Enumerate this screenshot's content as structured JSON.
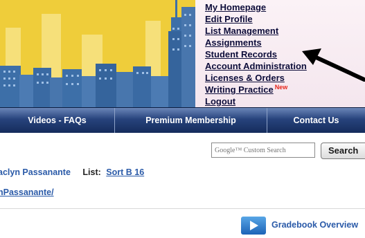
{
  "colors": {
    "banner_yellow": "#f1cf3a",
    "skyline_blue": "#3d6fa8",
    "menu_text": "#0d0d3a",
    "navbar_blue": "#1f3a72",
    "link_blue": "#2a5aa8",
    "new_badge": "#e8261b"
  },
  "header_menu": {
    "items": [
      {
        "label": "My Homepage"
      },
      {
        "label": "Edit Profile"
      },
      {
        "label": "List Management"
      },
      {
        "label": "Assignments"
      },
      {
        "label": "Student Records"
      },
      {
        "label": "Account Administration"
      },
      {
        "label": "Licenses & Orders"
      },
      {
        "label": "Writing Practice",
        "badge": "New"
      },
      {
        "label": "Logout"
      }
    ]
  },
  "navbar": {
    "items": [
      {
        "label": "Videos - FAQs"
      },
      {
        "label": "Premium Membership"
      },
      {
        "label": "Contact Us"
      }
    ]
  },
  "search": {
    "placeholder": "Google™ Custom Search",
    "button_label": "Search"
  },
  "content": {
    "user_name": "aclyn Passanante",
    "list_label": "List:",
    "list_value": "Sort B 16",
    "url_fragment": "nPassanante/",
    "gradebook_link": "Gradebook Overview"
  },
  "icons": {
    "arrow": "black-pointer-arrow-icon",
    "play": "video-play-icon"
  }
}
